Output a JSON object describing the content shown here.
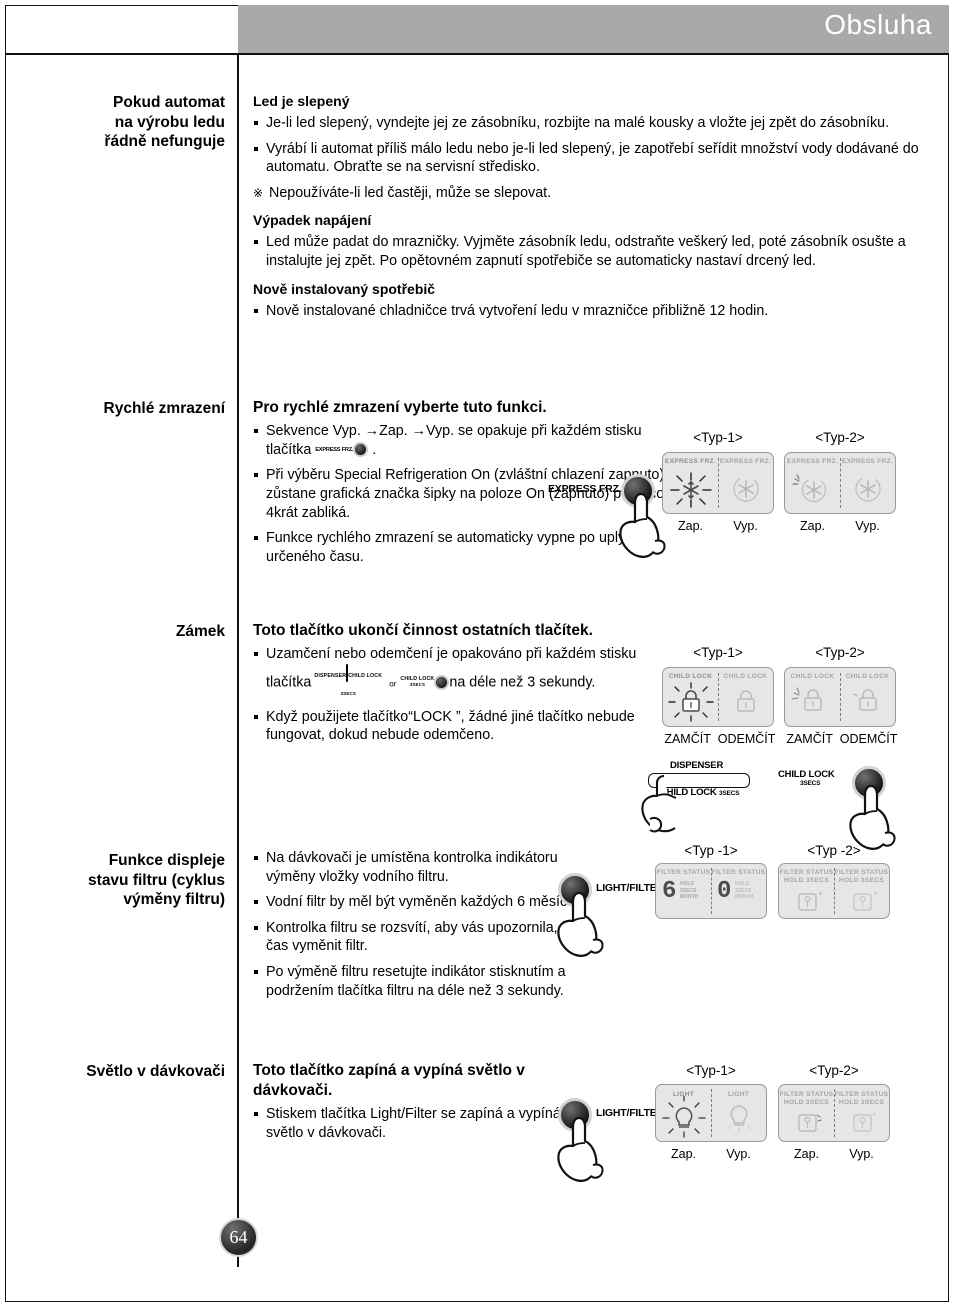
{
  "header": {
    "title": "Obsluha"
  },
  "page_number": "64",
  "sections": [
    {
      "label": "Pokud automat\nna výrobu ledu\nřádně nefunguje",
      "blocks": [
        {
          "heading": "Led je slepený",
          "items": [
            "Je-li led slepený, vyndejte jej ze zásobníku, rozbijte na malé kousky a vložte jej zpět do zásobníku.",
            "Vyrábí li automat příliš málo ledu nebo je-li led slepený, je zapotřebí seřídit množství vody dodávané do automatu. Obraťte se na servisní středisko.",
            "Nepoužíváte-li led častěji, může se slepovat."
          ]
        },
        {
          "heading": "Výpadek napájení",
          "items": [
            "Led může padat do mrazničky. Vyjměte zásobník ledu, odstraňte veškerý led, poté zásobník osušte a instalujte jej zpět. Po opětovném zapnutí spotřebiče se automaticky nastaví drcený led."
          ]
        },
        {
          "heading": "Nově instalovaný spotřebič",
          "items": [
            "Nově instalované chladničce trvá vytvoření ledu v mrazničce přibližně 12 hodin."
          ]
        }
      ]
    },
    {
      "label": "Rychlé zmrazení",
      "heading": "Pro rychlé zmrazení vyberte tuto funkci.",
      "items": [
        "Sekvence Vyp. →Zap. →Vyp. se opakuje při každém stisku tlačítka",
        "Při výběru Special Refrigeration On (zvláštní chlazení zapnuto) zůstane grafická značka šipky na poloze On (zapnuto) poté, co 4krát zabliká.",
        "Funkce rychlého zmrazení se automaticky vypne po uplynutí určeného času."
      ],
      "press_label": "EXPRESS FRZ.",
      "panels": [
        {
          "type_label": "<Typ-1>",
          "cells": [
            {
              "mini": "EXPRESS FRZ.",
              "cap": "Zap.",
              "icon": "snowflake-lit"
            },
            {
              "mini": "EXPRESS FRZ.",
              "cap": "Vyp.",
              "icon": "snowflake-dim"
            }
          ]
        },
        {
          "type_label": "<Typ-2>",
          "cells": [
            {
              "mini": "EXPRESS FRZ.",
              "cap": "Zap.",
              "icon": "snowflake-spark"
            },
            {
              "mini": "EXPRESS FRZ.",
              "cap": "Vyp.",
              "icon": "snowflake-dim"
            }
          ]
        }
      ]
    },
    {
      "label": "Zámek",
      "heading": "Toto tlačítko ukončí činnost ostatních tlačítek.",
      "items": [
        {
          "pre": "Uzamčení nebo odemčení je opakováno při každém stisku tlačítka",
          "mid": "or",
          "post": "na déle než 3 sekundy."
        },
        {
          "text": "Když použijete tlačítko“LOCK ”, žádné jiné tlačítko nebude fungovat, dokud nebude odemčeno."
        }
      ],
      "chip_dispenser": {
        "top": "DISPENSER",
        "bottom": "CHILD LOCK",
        "bottom_small": "3SECS"
      },
      "chip_childlock": {
        "top": "CHILD LOCK",
        "bottom": "3SECS"
      },
      "panels": [
        {
          "type_label": "<Typ-1>",
          "cells": [
            {
              "mini": "CHILD LOCK",
              "cap": "ZAMČÍT",
              "icon": "lock-lit"
            },
            {
              "mini": "CHILD LOCK",
              "cap": "ODEMČÍT",
              "icon": "lock-dim"
            }
          ]
        },
        {
          "type_label": "<Typ-2>",
          "cells": [
            {
              "mini": "CHILD LOCK",
              "cap": "ZAMČÍT",
              "icon": "lock-spark"
            },
            {
              "mini": "CHILD LOCK",
              "cap": "ODEMČÍT",
              "icon": "lock-dim"
            }
          ]
        }
      ],
      "press_dispenser": {
        "top": "DISPENSER",
        "bottom": "CHILD LOCK",
        "secs": "3SECS"
      },
      "press_childlock": {
        "top": "CHILD LOCK",
        "secs": "3SECS"
      }
    },
    {
      "label": "Funkce displeje\nstavu filtru (cyklus\nvýměny filtru)",
      "items": [
        "Na dávkovači je umístěna kontrolka indikátoru výměny vložky vodního filtru.",
        "Vodní filtr by měl být vyměněn každých 6 měsíců.",
        "Kontrolka filtru se rozsvítí, aby vás upozornila, že je čas vyměnit filtr.",
        "Po výměně filtru resetujte indikátor stisknutím a podržením tlačítka filtru na déle než 3 sekundy."
      ],
      "press_label": "LIGHT/FILTER",
      "panels": [
        {
          "type_label": "<Typ -1>",
          "cells": [
            {
              "mini": "FILTER STATUS",
              "sub": "HOLD\n3SECS\nMONTH",
              "digit": "6",
              "cap": "",
              "icon": "seven-seg"
            },
            {
              "mini": "FILTER STATUS",
              "sub": "HOLD\n3SECS\nMONTH",
              "digit": "0",
              "cap": "",
              "icon": "seven-seg"
            }
          ]
        },
        {
          "type_label": "<Typ -2>",
          "cells": [
            {
              "mini": "FILTER STATUS\nHOLD 3SECS",
              "cap": "",
              "icon": "filter-lit"
            },
            {
              "mini": "FILTER STATUS\nHOLD 3SECS",
              "cap": "",
              "icon": "filter-dim"
            }
          ]
        }
      ]
    },
    {
      "label": "Světlo v dávkovači",
      "heading": "Toto tlačítko zapíná a vypíná světlo v dávkovači.",
      "items": [
        "Stiskem tlačítka Light/Filter se zapíná a vypíná světlo v dávkovači."
      ],
      "press_label": "LIGHT/FILTER",
      "panels": [
        {
          "type_label": "<Typ-1>",
          "cells": [
            {
              "mini": "LIGHT",
              "cap": "Zap.",
              "icon": "bulb-lit"
            },
            {
              "mini": "LIGHT",
              "cap": "Vyp.",
              "icon": "bulb-dim"
            }
          ]
        },
        {
          "type_label": "<Typ-2>",
          "cells": [
            {
              "mini": "FILTER STATUS\nHOLD 3SECS",
              "cap": "Zap.",
              "icon": "filter-lit"
            },
            {
              "mini": "FILTER STATUS\nHOLD 3SECS",
              "cap": "Vyp.",
              "icon": "filter-dim"
            }
          ]
        }
      ]
    }
  ]
}
